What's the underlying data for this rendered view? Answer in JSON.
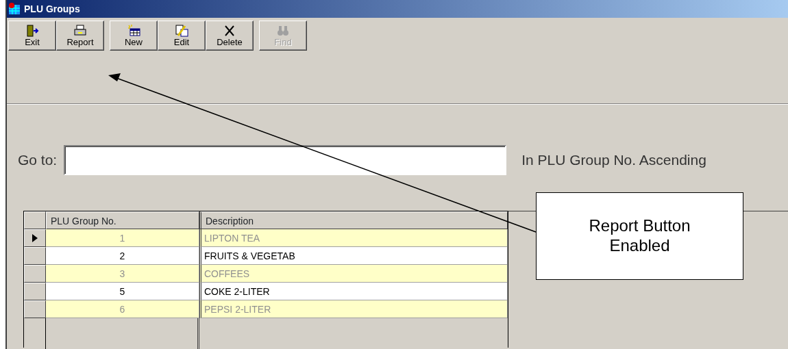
{
  "window": {
    "title": "PLU Groups"
  },
  "toolbar": [
    {
      "kind": "exit",
      "label": "Exit",
      "disabled": false
    },
    {
      "kind": "report",
      "label": "Report",
      "disabled": false
    },
    {
      "kind": "new",
      "label": "New",
      "disabled": false
    },
    {
      "kind": "edit",
      "label": "Edit",
      "disabled": false
    },
    {
      "kind": "delete",
      "label": "Delete",
      "disabled": false
    },
    {
      "kind": "find",
      "label": "Find",
      "disabled": true
    }
  ],
  "goto": {
    "label": "Go to:",
    "order_text": "In PLU Group No. Ascending"
  },
  "table": {
    "columns": [
      "PLU Group No.",
      "Description"
    ],
    "rows": [
      {
        "number": "1",
        "description": "LIPTON TEA",
        "shaded": true,
        "selected": true
      },
      {
        "number": "2",
        "description": "FRUITS & VEGETAB",
        "shaded": false,
        "selected": false
      },
      {
        "number": "3",
        "description": "COFFEES",
        "shaded": true,
        "selected": false
      },
      {
        "number": "5",
        "description": "COKE 2-LITER",
        "shaded": false,
        "selected": false
      },
      {
        "number": "6",
        "description": "PEPSI 2-LITER",
        "shaded": true,
        "selected": false
      }
    ]
  },
  "callout": {
    "text": "Report Button Enabled"
  }
}
